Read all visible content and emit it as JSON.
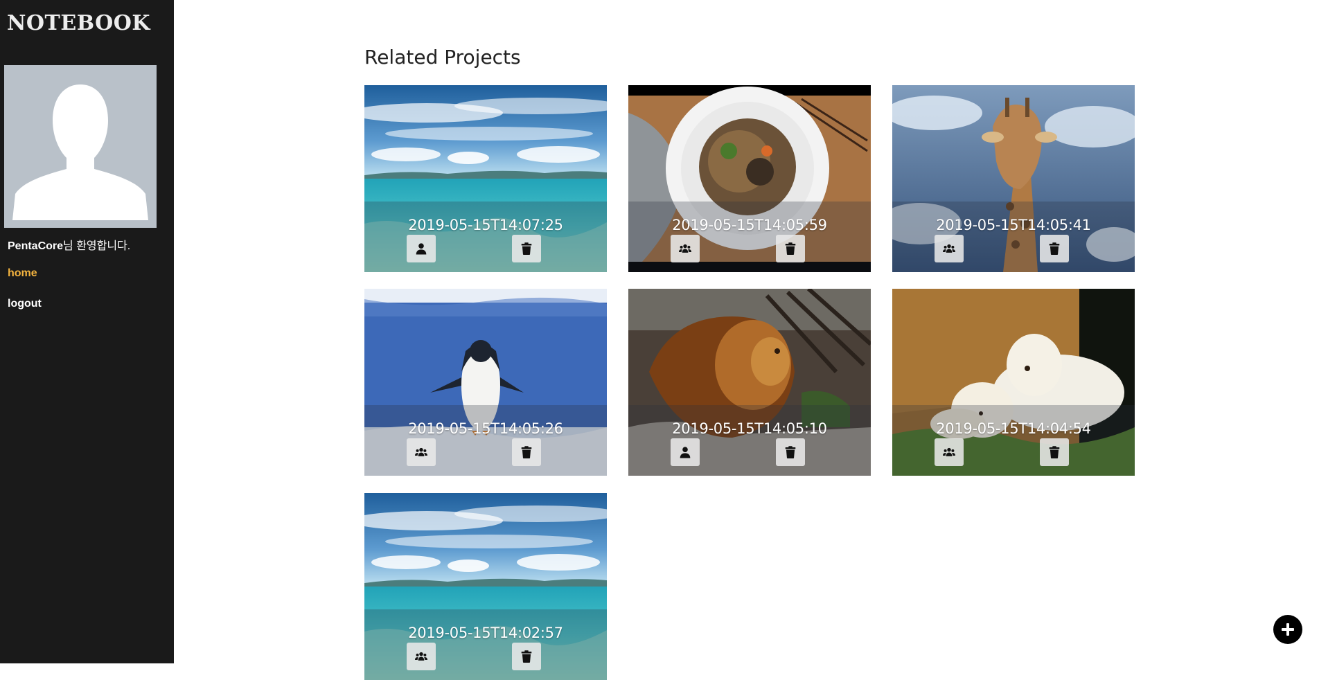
{
  "sidebar": {
    "brand": "NOTEBOOK",
    "user_name": "PentaCore",
    "welcome_suffix": "님 환영합니다.",
    "nav": [
      {
        "label": "home",
        "active": true
      },
      {
        "label": "logout",
        "active": false
      }
    ]
  },
  "main": {
    "title": "Related Projects",
    "projects": [
      {
        "date": "2019-05-15T14:07:25",
        "image": "ocean-sky",
        "share_icon": "user-icon",
        "delete_icon": "trash-icon"
      },
      {
        "date": "2019-05-15T14:05:59",
        "image": "noodle-dish",
        "share_icon": "users-icon",
        "delete_icon": "trash-icon"
      },
      {
        "date": "2019-05-15T14:05:41",
        "image": "giraffe",
        "share_icon": "users-icon",
        "delete_icon": "trash-icon"
      },
      {
        "date": "2019-05-15T14:05:26",
        "image": "penguin",
        "share_icon": "users-icon",
        "delete_icon": "trash-icon"
      },
      {
        "date": "2019-05-15T14:05:10",
        "image": "lion",
        "share_icon": "user-icon",
        "delete_icon": "trash-icon"
      },
      {
        "date": "2019-05-15T14:04:54",
        "image": "dogs",
        "share_icon": "users-icon",
        "delete_icon": "trash-icon"
      },
      {
        "date": "2019-05-15T14:02:57",
        "image": "ocean-sky",
        "share_icon": "users-icon",
        "delete_icon": "trash-icon"
      }
    ]
  },
  "fab": {
    "icon": "plus-icon"
  },
  "colors": {
    "sidebar_bg": "#1a1a1a",
    "nav_active": "#f4b43f",
    "avatar_bg": "#b9c1c9"
  }
}
